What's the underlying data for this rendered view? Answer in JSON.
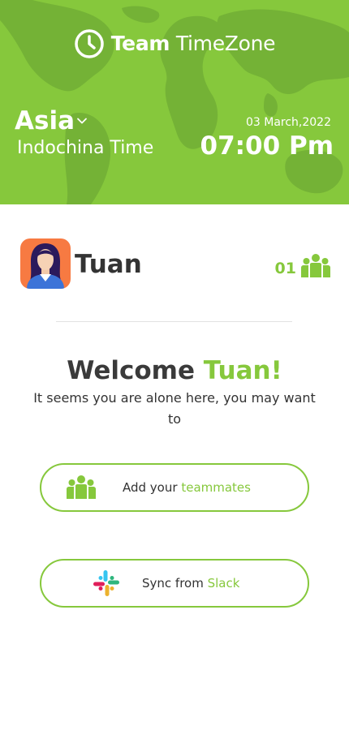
{
  "colors": {
    "accent": "#86c83c",
    "text": "#333333",
    "header_bg": "#86c83c",
    "avatar_bg": "#f77a42"
  },
  "header": {
    "brand_bold": "Team",
    "brand_rest": "TimeZone",
    "brand_icon": "clock-icon",
    "region": "Asia",
    "region_icon": "chevron-down-icon",
    "timezone": "Indochina Time",
    "date": "03 March,2022",
    "time": "07:00 Pm"
  },
  "user": {
    "name": "Tuan",
    "avatar_icon": "woman-avatar",
    "member_count": "01",
    "members_icon": "team-icon"
  },
  "welcome": {
    "prefix": "Welcome",
    "name": "Tuan!",
    "subtitle": "It seems you are alone here,  you may want to"
  },
  "actions": {
    "add_teammates": {
      "prefix": "Add your",
      "accent": "teammates",
      "icon": "team-icon"
    },
    "sync_slack": {
      "prefix": "Sync from",
      "accent": "Slack",
      "icon": "slack-icon"
    }
  }
}
